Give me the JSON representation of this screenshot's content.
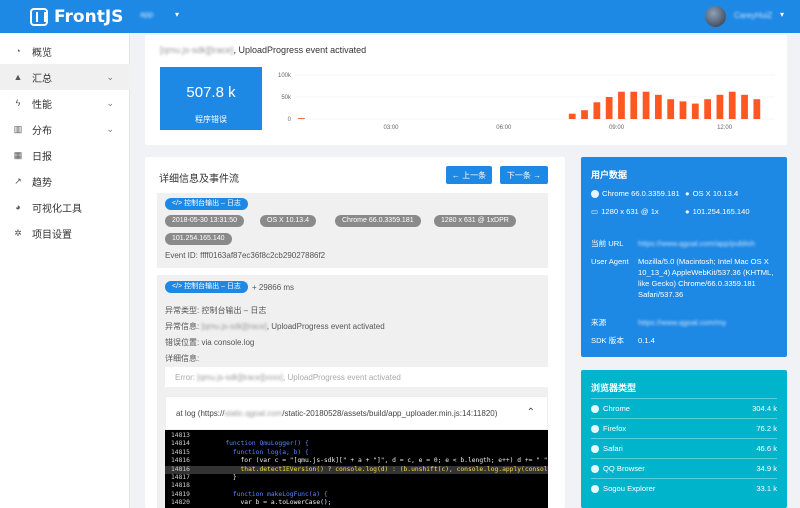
{
  "header": {
    "logo_text": "FrontJS",
    "app_select": "app",
    "user_name": "CareyHuiZ",
    "caret": "▾"
  },
  "sidebar": {
    "items": [
      {
        "label": "概览",
        "icon": "dashboard-icon",
        "glyph": "◔",
        "active": false,
        "chevron": false
      },
      {
        "label": "汇总",
        "icon": "warning-icon",
        "glyph": "▲",
        "active": true,
        "chevron": true
      },
      {
        "label": "性能",
        "icon": "lightning-icon",
        "glyph": "ϟ",
        "active": false,
        "chevron": true
      },
      {
        "label": "分布",
        "icon": "bar-chart-icon",
        "glyph": "▥",
        "active": false,
        "chevron": true
      },
      {
        "label": "日报",
        "icon": "calendar-icon",
        "glyph": "▦",
        "active": false,
        "chevron": false
      },
      {
        "label": "趋势",
        "icon": "line-chart-icon",
        "glyph": "↗",
        "active": false,
        "chevron": false
      },
      {
        "label": "可视化工具",
        "icon": "pie-chart-icon",
        "glyph": "◕",
        "active": false,
        "chevron": false
      },
      {
        "label": "项目设置",
        "icon": "gear-icon",
        "glyph": "✲",
        "active": false,
        "chevron": false
      }
    ],
    "chevron_glyph": "⌄"
  },
  "summary": {
    "event_prefix": "[qmu.js-sdk][trace]",
    "event_text": ", UploadProgress event activated",
    "error_count": "507.8 k",
    "error_label": "程序错误"
  },
  "chart_data": {
    "type": "bar",
    "y_ticks": [
      "100k",
      "50k",
      "0"
    ],
    "x_ticks": [
      "03:00",
      "06:00",
      "09:00",
      "12:00"
    ],
    "ylim": [
      0,
      100000
    ],
    "bar_color": "#ff5722",
    "values": [
      2000,
      0,
      0,
      0,
      0,
      0,
      0,
      0,
      0,
      0,
      0,
      0,
      0,
      0,
      0,
      0,
      0,
      0,
      0,
      0,
      0,
      0,
      12000,
      20000,
      38000,
      50000,
      62000,
      62000,
      62000,
      55000,
      45000,
      40000,
      35000,
      45000,
      55000,
      62000,
      55000,
      45000,
      0
    ]
  },
  "detail": {
    "title": "详细信息及事件流",
    "prev_button": "← 上一条",
    "next_button": "下一条 →",
    "event1": {
      "tag": "</> 控制台输出 – 日志",
      "date": "2018-05-30 13:31:50",
      "os": "OS X 10.13.4",
      "browser": "Chrome 66.0.3359.181",
      "screen": "1280 x 631 @ 1xDPR",
      "ip": "101.254.165.140",
      "event_id": "Event ID: ffff0163af87ec36f8c2cb29027886f2"
    },
    "event2": {
      "tag": "</> 控制台输出 – 日志",
      "delta": "+ 29866 ms",
      "type_line": "异常类型: 控制台输出 – 日志",
      "info_prefix": "异常信息: ",
      "info_blur": "[qmu.js-sdk][trace]",
      "info_text": ", UploadProgress event activated",
      "position_line": "错误位置: via console.log",
      "detail_label": "详细信息:",
      "error_prefix": "Error: ",
      "error_blur": "[qmu.js-sdk][trace][xxxx]",
      "error_text": ", UploadProgress event activated"
    },
    "code": {
      "header_prefix": "at log (https://",
      "header_blur": "static.qgoal.com",
      "header_suffix": "/static-20180528/assets/build/app_uploader.min.js:14:11820)",
      "lines": [
        {
          "n": "14813",
          "t": ""
        },
        {
          "n": "14814",
          "t": "        function QmuLogger() {"
        },
        {
          "n": "14815",
          "t": "          function log(a, b) {"
        },
        {
          "n": "14816",
          "t": "            for (var c = \"[qmu.js-sdk][\" + a + \"]\", d = c, e = 0; e < b.length; e++) d += \" \""
        },
        {
          "n": "14816",
          "t": "            that.detectIEVersion() ? console.log(d) : (b.unshift(c), console.log.apply(console"
        },
        {
          "n": "14817",
          "t": "          }"
        },
        {
          "n": "14818",
          "t": ""
        },
        {
          "n": "14819",
          "t": "          function makeLogFunc(a) {"
        },
        {
          "n": "14820",
          "t": "            var b = a.toLowerCase();"
        }
      ]
    }
  },
  "user_data": {
    "title": "用户数据",
    "browser": "Chrome 66.0.3359.181",
    "os": "OS X 10.13.4",
    "screen": "1280 x 631 @ 1x",
    "ip": "101.254.165.140",
    "rows": [
      {
        "label": "当前 URL",
        "value": "https://www.qgoal.com/app/publish"
      },
      {
        "label": "User Agent",
        "value": "Mozilla/5.0 (Macintosh; Intel Mac OS X 10_13_4) AppleWebKit/537.36 (KHTML, like Gecko) Chrome/66.0.3359.181 Safari/537.36"
      },
      {
        "label": "来源",
        "value": "https://www.qgoal.com/my"
      },
      {
        "label": "SDK 版本",
        "value": "0.1.4"
      }
    ]
  },
  "browser_types": {
    "title": "浏览器类型",
    "items": [
      {
        "name": "Chrome",
        "value": "304.4 k",
        "icon": "chrome-icon"
      },
      {
        "name": "Firefox",
        "value": "76.2 k",
        "icon": "firefox-icon"
      },
      {
        "name": "Safari",
        "value": "46.6 k",
        "icon": "safari-icon"
      },
      {
        "name": "QQ Browser",
        "value": "34.9 k",
        "icon": "qq-icon"
      },
      {
        "name": "Sogou Explorer",
        "value": "33.1 k",
        "icon": "question-icon"
      }
    ]
  }
}
